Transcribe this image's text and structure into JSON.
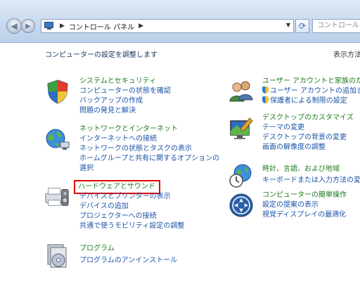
{
  "addressbar": {
    "crumb": "コントロール パネル",
    "search_placeholder": "コントロール"
  },
  "header": {
    "adjust_text": "コンピューターの設定を調整します",
    "viewby": "表示方法"
  },
  "left": [
    {
      "title": "システムとセキュリティ",
      "icon": "shield-icon",
      "links": [
        "コンピューターの状態を確認",
        "バックアップの作成",
        "問題の発見と解決"
      ]
    },
    {
      "title": "ネットワークとインターネット",
      "icon": "network-globe-icon",
      "links": [
        "インターネットへの接続",
        "ネットワークの状態とタスクの表示",
        "ホームグループと共有に関するオプションの選択"
      ]
    },
    {
      "title": "ハードウェアとサウンド",
      "icon": "printer-speaker-icon",
      "links": [
        "デバイスとプリンターの表示",
        "デバイスの追加",
        "プロジェクターへの接続",
        "共通で使うモビリティ設定の調整"
      ]
    },
    {
      "title": "プログラム",
      "icon": "programs-disc-icon",
      "links": [
        "プログラムのアンインストール"
      ]
    }
  ],
  "right": [
    {
      "title": "ユーザー アカウントと家族のた",
      "icon": "user-accounts-icon",
      "links": [
        "ユーザー アカウントの追加ま",
        "保護者による制限の設定"
      ]
    },
    {
      "title": "デスクトップのカスタマイズ",
      "icon": "monitor-customize-icon",
      "links": [
        "テーマの変更",
        "デスクトップの背景の変更",
        "画面の解像度の調整"
      ]
    },
    {
      "title": "時計、言語、および地域",
      "icon": "clock-globe-icon",
      "links": [
        "キーボードまたは入力方法の変更"
      ]
    },
    {
      "title": "コンピューターの簡単操作",
      "icon": "ease-of-access-icon",
      "links": [
        "設定の提案の表示",
        "視覚ディスプレイの最適化"
      ]
    }
  ]
}
